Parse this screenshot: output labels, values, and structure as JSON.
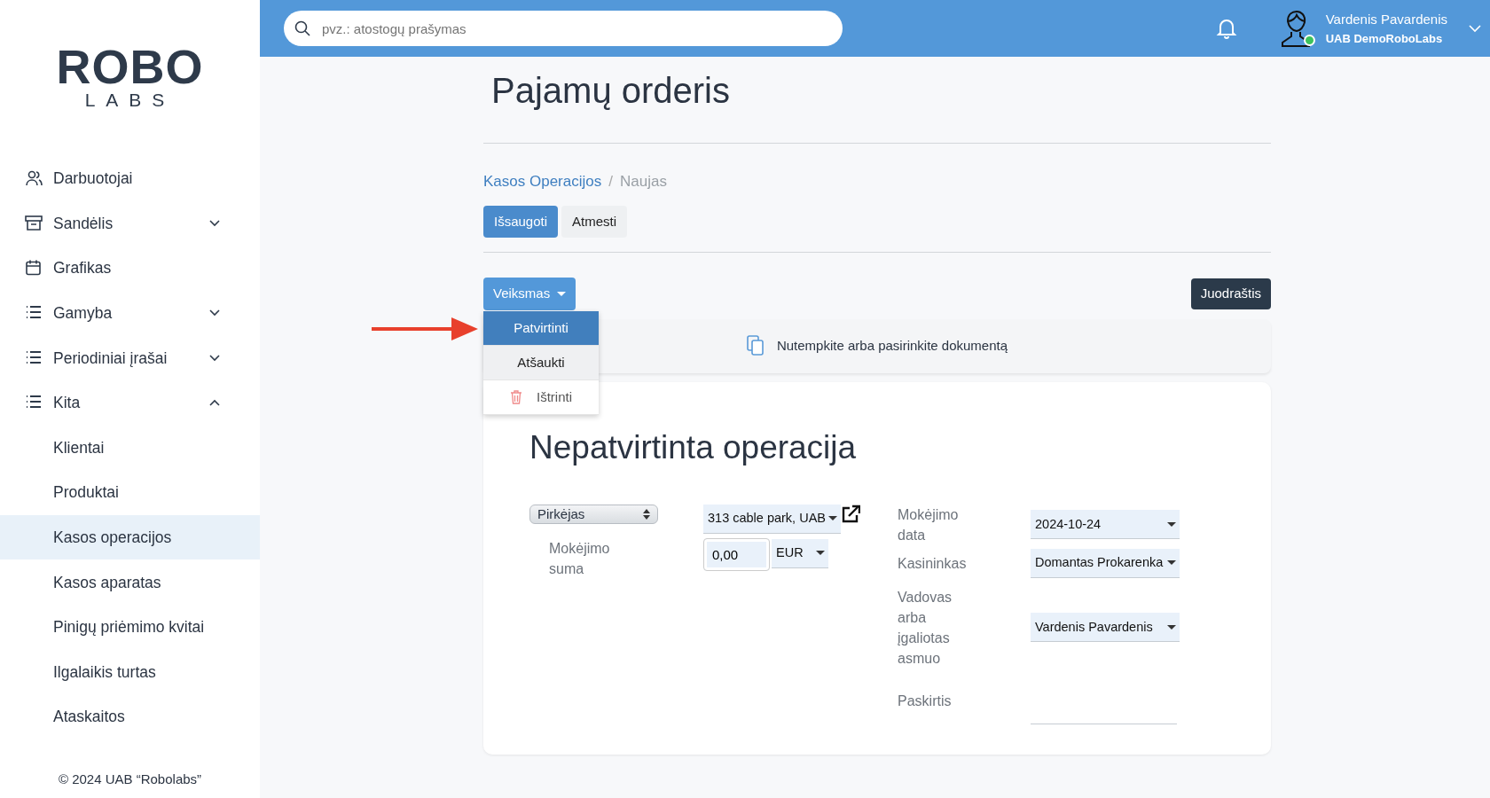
{
  "logo": {
    "top": "ROBO",
    "bottom": "LABS"
  },
  "sidebar": {
    "items": [
      {
        "label": "Darbuotojai"
      },
      {
        "label": "Sandėlis",
        "expanded": false
      },
      {
        "label": "Grafikas"
      },
      {
        "label": "Gamyba",
        "expanded": false
      },
      {
        "label": "Periodiniai įrašai",
        "expanded": false
      },
      {
        "label": "Kita",
        "expanded": true,
        "children": [
          {
            "label": "Klientai",
            "selected": false
          },
          {
            "label": "Produktai",
            "selected": false
          },
          {
            "label": "Kasos operacijos",
            "selected": true
          },
          {
            "label": "Kasos aparatas",
            "selected": false
          },
          {
            "label": "Pinigų priėmimo kvitai",
            "selected": false
          },
          {
            "label": "Ilgalaikis turtas",
            "selected": false
          },
          {
            "label": "Ataskaitos",
            "selected": false
          }
        ]
      }
    ],
    "footer": "© 2024 UAB “Robolabs”"
  },
  "topbar": {
    "search": {
      "placeholder": "pvz.: atostogų prašymas"
    },
    "user": {
      "name": "Vardenis Pavardenis",
      "company": "UAB DemoRoboLabs",
      "online": true
    }
  },
  "page": {
    "title": "Pajamų orderis",
    "breadcrumb": [
      {
        "label": "Kasos Operacijos",
        "selected": false
      },
      {
        "label": "Naujas",
        "selected": true
      }
    ],
    "breadcrumb_separator": "/",
    "buttons": [
      {
        "label": "Išsaugoti",
        "kind": "primary"
      },
      {
        "label": "Atmesti",
        "kind": "secondary"
      }
    ],
    "action_menu": {
      "label": "Veiksmas",
      "expanded": true,
      "items": [
        {
          "label": "Patvirtinti",
          "kind": "plain",
          "selected": true,
          "hovered": false
        },
        {
          "label": "Atšaukti",
          "kind": "plain",
          "selected": false,
          "hovered": true
        },
        {
          "label": "Ištrinti",
          "kind": "delete",
          "selected": false,
          "hovered": false
        }
      ]
    },
    "status_button": "Juodraštis",
    "upload": "Nutempkite arba pasirinkite dokumentą",
    "form": {
      "title": "Nepatvirtinta operacija",
      "role": "Pirkėjas",
      "partner": "313 cable park, UAB",
      "amount_label": "Mokėjimo suma",
      "amount": "0,00",
      "currency": "EUR",
      "fields": [
        {
          "label": "Mokėjimo data",
          "value": "2024-10-24",
          "kind": "select"
        },
        {
          "label": "Kasininkas",
          "value": "Domantas Prokarenka",
          "kind": "select"
        },
        {
          "label": "Vadovas arba įgaliotas asmuo",
          "value": "Vardenis Pavardenis",
          "kind": "select"
        },
        {
          "label": "Paskirtis",
          "kind": "text"
        }
      ]
    }
  }
}
